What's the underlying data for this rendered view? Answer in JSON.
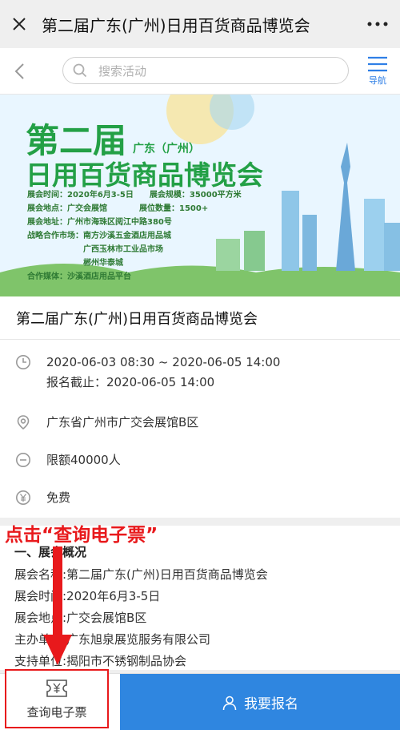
{
  "titlebar": {
    "title": "第二届广东(广州)日用百货商品博览会"
  },
  "search": {
    "placeholder": "搜索活动"
  },
  "nav": {
    "label": "导航"
  },
  "banner": {
    "line1": "第二届",
    "line1_small": "广东（广州）",
    "line2": "日用百货商品博览会",
    "info": [
      "展会时间：2020年6月3-5日　　展会规模：35000平方米",
      "展会地点：广交会展馆　　　　展位数量：1500+",
      "展会地址：广州市海珠区阅江中路380号",
      "战略合作市场：南方沙溪五金酒店用品城",
      "　　　　　　　广西玉林市工业品市场",
      "　　　　　　　郴州华泰城",
      "合作媒体：沙溪酒店用品平台"
    ]
  },
  "event": {
    "name": "第二届广东(广州)日用百货商品博览会",
    "time_range": "2020-06-03 08:30 ~ 2020-06-05 14:00",
    "deadline": "报名截止：2020-06-05 14:00",
    "location": "广东省广州市广交会展馆B区",
    "quota": "限额40000人",
    "fee": "免费"
  },
  "overview": {
    "heading": "一、展会概况",
    "lines": [
      "展会名称:第二届广东(广州)日用百货商品博览会",
      "展会时间:2020年6月3-5日",
      "展会地点:广交会展馆B区",
      "主办单位:广东旭泉展览服务有限公司",
      "支持单位:揭阳市不锈钢制品协会"
    ]
  },
  "annotation": {
    "text": "点击“查询电子票”"
  },
  "bottom": {
    "ticket_label": "查询电子票",
    "signup_label": "我要报名"
  },
  "colors": {
    "accent": "#2f86e0",
    "annotation": "#e8191c",
    "banner_green": "#23a046"
  }
}
